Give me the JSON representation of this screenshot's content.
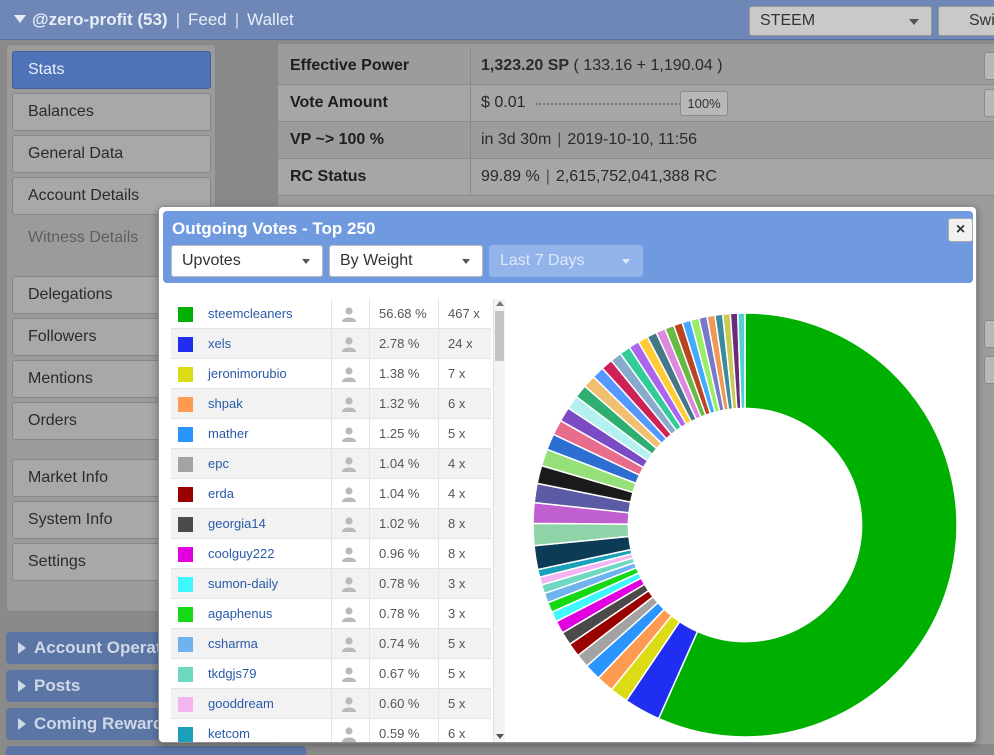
{
  "header": {
    "account": "@zero-profit (53)",
    "links": [
      "Feed",
      "Wallet"
    ],
    "chain_select": "STEEM",
    "switch_button": "Swi"
  },
  "sidebar": {
    "items": [
      {
        "label": "Stats",
        "active": true
      },
      {
        "label": "Balances"
      },
      {
        "label": "General Data"
      },
      {
        "label": "Account Details"
      },
      {
        "label": "Witness Details",
        "disabled": true
      },
      {
        "label": "Delegations"
      },
      {
        "label": "Followers"
      },
      {
        "label": "Mentions"
      },
      {
        "label": "Orders"
      },
      {
        "label": "Market Info"
      },
      {
        "label": "System Info"
      },
      {
        "label": "Settings"
      }
    ],
    "sections": [
      "Account Operatio",
      "Posts",
      "Coming Rewards"
    ]
  },
  "stats": {
    "effective_power": {
      "label": "Effective Power",
      "value_bold": "1,323.20 SP",
      "value_rest": " ( 133.16 + 1,190.04 )"
    },
    "vote_amount": {
      "label": "Vote Amount",
      "value": "$ 0.01",
      "percent_button": "100%"
    },
    "vp": {
      "label": "VP ~> 100 %",
      "value_a": "in 3d 30m",
      "value_b": "2019-10-10, 11:56"
    },
    "rc": {
      "label": "RC Status",
      "value_a": "99.89 %",
      "value_b": "2,615,752,041,388 RC"
    }
  },
  "modal": {
    "title": "Outgoing Votes - Top 250",
    "close": "×",
    "selects": {
      "type": "Upvotes",
      "sort": "By Weight",
      "period": "Last 7 Days"
    }
  },
  "votes": [
    {
      "name": "steemcleaners",
      "pct": "56.68 %",
      "count": "467 x",
      "color": "#00b000"
    },
    {
      "name": "xels",
      "pct": "2.78 %",
      "count": "24 x",
      "color": "#1f2ef0"
    },
    {
      "name": "jeronimorubio",
      "pct": "1.38 %",
      "count": "7 x",
      "color": "#dcdc16"
    },
    {
      "name": "shpak",
      "pct": "1.32 %",
      "count": "6 x",
      "color": "#ff9a52"
    },
    {
      "name": "mather",
      "pct": "1.25 %",
      "count": "5 x",
      "color": "#2b95ff"
    },
    {
      "name": "epc",
      "pct": "1.04 %",
      "count": "4 x",
      "color": "#a3a3a3"
    },
    {
      "name": "erda",
      "pct": "1.04 %",
      "count": "4 x",
      "color": "#990000"
    },
    {
      "name": "georgia14",
      "pct": "1.02 %",
      "count": "8 x",
      "color": "#4a4a4a"
    },
    {
      "name": "coolguy222",
      "pct": "0.96 %",
      "count": "8 x",
      "color": "#e000e0"
    },
    {
      "name": "sumon-daily",
      "pct": "0.78 %",
      "count": "3 x",
      "color": "#3ff7ff"
    },
    {
      "name": "agaphenus",
      "pct": "0.78 %",
      "count": "3 x",
      "color": "#16d916"
    },
    {
      "name": "csharma",
      "pct": "0.74 %",
      "count": "5 x",
      "color": "#6fb3ee"
    },
    {
      "name": "tkdgjs79",
      "pct": "0.67 %",
      "count": "5 x",
      "color": "#6ed8c0"
    },
    {
      "name": "gooddream",
      "pct": "0.60 %",
      "count": "5 x",
      "color": "#f2b5f2"
    },
    {
      "name": "ketcom",
      "pct": "0.59 %",
      "count": "6 x",
      "color": "#1aa0b8"
    }
  ],
  "chart_data": {
    "type": "pie",
    "categories": [
      "steemcleaners",
      "xels",
      "jeronimorubio",
      "shpak",
      "mather",
      "epc",
      "erda",
      "georgia14",
      "coolguy222",
      "sumon-daily",
      "agaphenus",
      "csharma",
      "tkdgjs79",
      "gooddream",
      "ketcom"
    ],
    "values": [
      56.68,
      2.78,
      1.38,
      1.32,
      1.25,
      1.04,
      1.04,
      1.02,
      0.96,
      0.78,
      0.78,
      0.74,
      0.67,
      0.6,
      0.59
    ],
    "remainder_percent": 28.37,
    "remainder_colors": [
      "#0b3b55",
      "#8fd3a8",
      "#c05fd0",
      "#5a5aa5",
      "#1a1a1a",
      "#96e07a",
      "#2c6fd1",
      "#e86d8c",
      "#7a4bc2",
      "#b5f0f0",
      "#2fae72",
      "#f0c070",
      "#5599ff",
      "#cc2255",
      "#88aacc",
      "#33cc99",
      "#aa66ee",
      "#ffcc33",
      "#447788",
      "#dd88dd",
      "#66bb44",
      "#bb4422",
      "#44aaff",
      "#99ee66",
      "#7777cc",
      "#ee9955",
      "#3c8a9e",
      "#c9c955",
      "#6b2b7a",
      "#55d0d0"
    ],
    "hole": 0.55
  }
}
